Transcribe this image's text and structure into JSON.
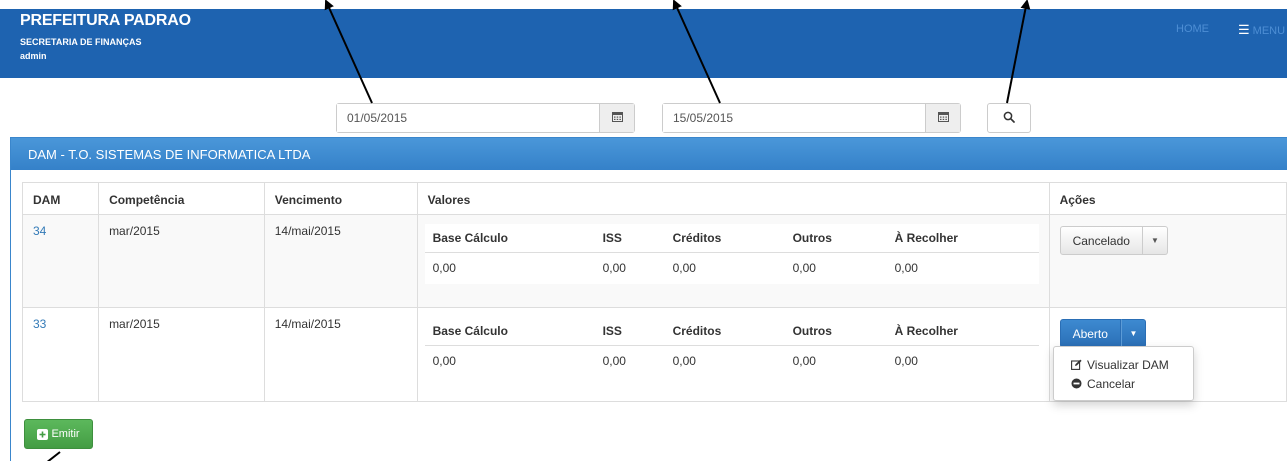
{
  "header": {
    "title": "PREFEITURA PADRAO",
    "subtitle": "SECRETARIA DE FINANÇAS",
    "user": "admin",
    "nav_home": "HOME",
    "nav_menu": "MENU"
  },
  "filters": {
    "date_from": "01/05/2015",
    "date_to": "15/05/2015"
  },
  "panel": {
    "title": "DAM - T.O. SISTEMAS DE INFORMATICA LTDA"
  },
  "table": {
    "headers": [
      "DAM",
      "Competência",
      "Vencimento",
      "Valores",
      "Ações"
    ],
    "values_headers": [
      "Base Cálculo",
      "ISS",
      "Créditos",
      "Outros",
      "À Recolher"
    ],
    "rows": [
      {
        "dam": "34",
        "competencia": "mar/2015",
        "vencimento": "14/mai/2015",
        "values": [
          "0,00",
          "0,00",
          "0,00",
          "0,00",
          "0,00"
        ],
        "status": "Cancelado"
      },
      {
        "dam": "33",
        "competencia": "mar/2015",
        "vencimento": "14/mai/2015",
        "values": [
          "0,00",
          "0,00",
          "0,00",
          "0,00",
          "0,00"
        ],
        "status": "Aberto"
      }
    ]
  },
  "dropdown": {
    "items": [
      "Visualizar DAM",
      "Cancelar"
    ]
  },
  "actions": {
    "emitir": "Emitir"
  },
  "colors": {
    "navbar": "#1e63b0",
    "panel_heading": "#3a86cc",
    "primary": "#2a6eb5",
    "success": "#449d44"
  }
}
